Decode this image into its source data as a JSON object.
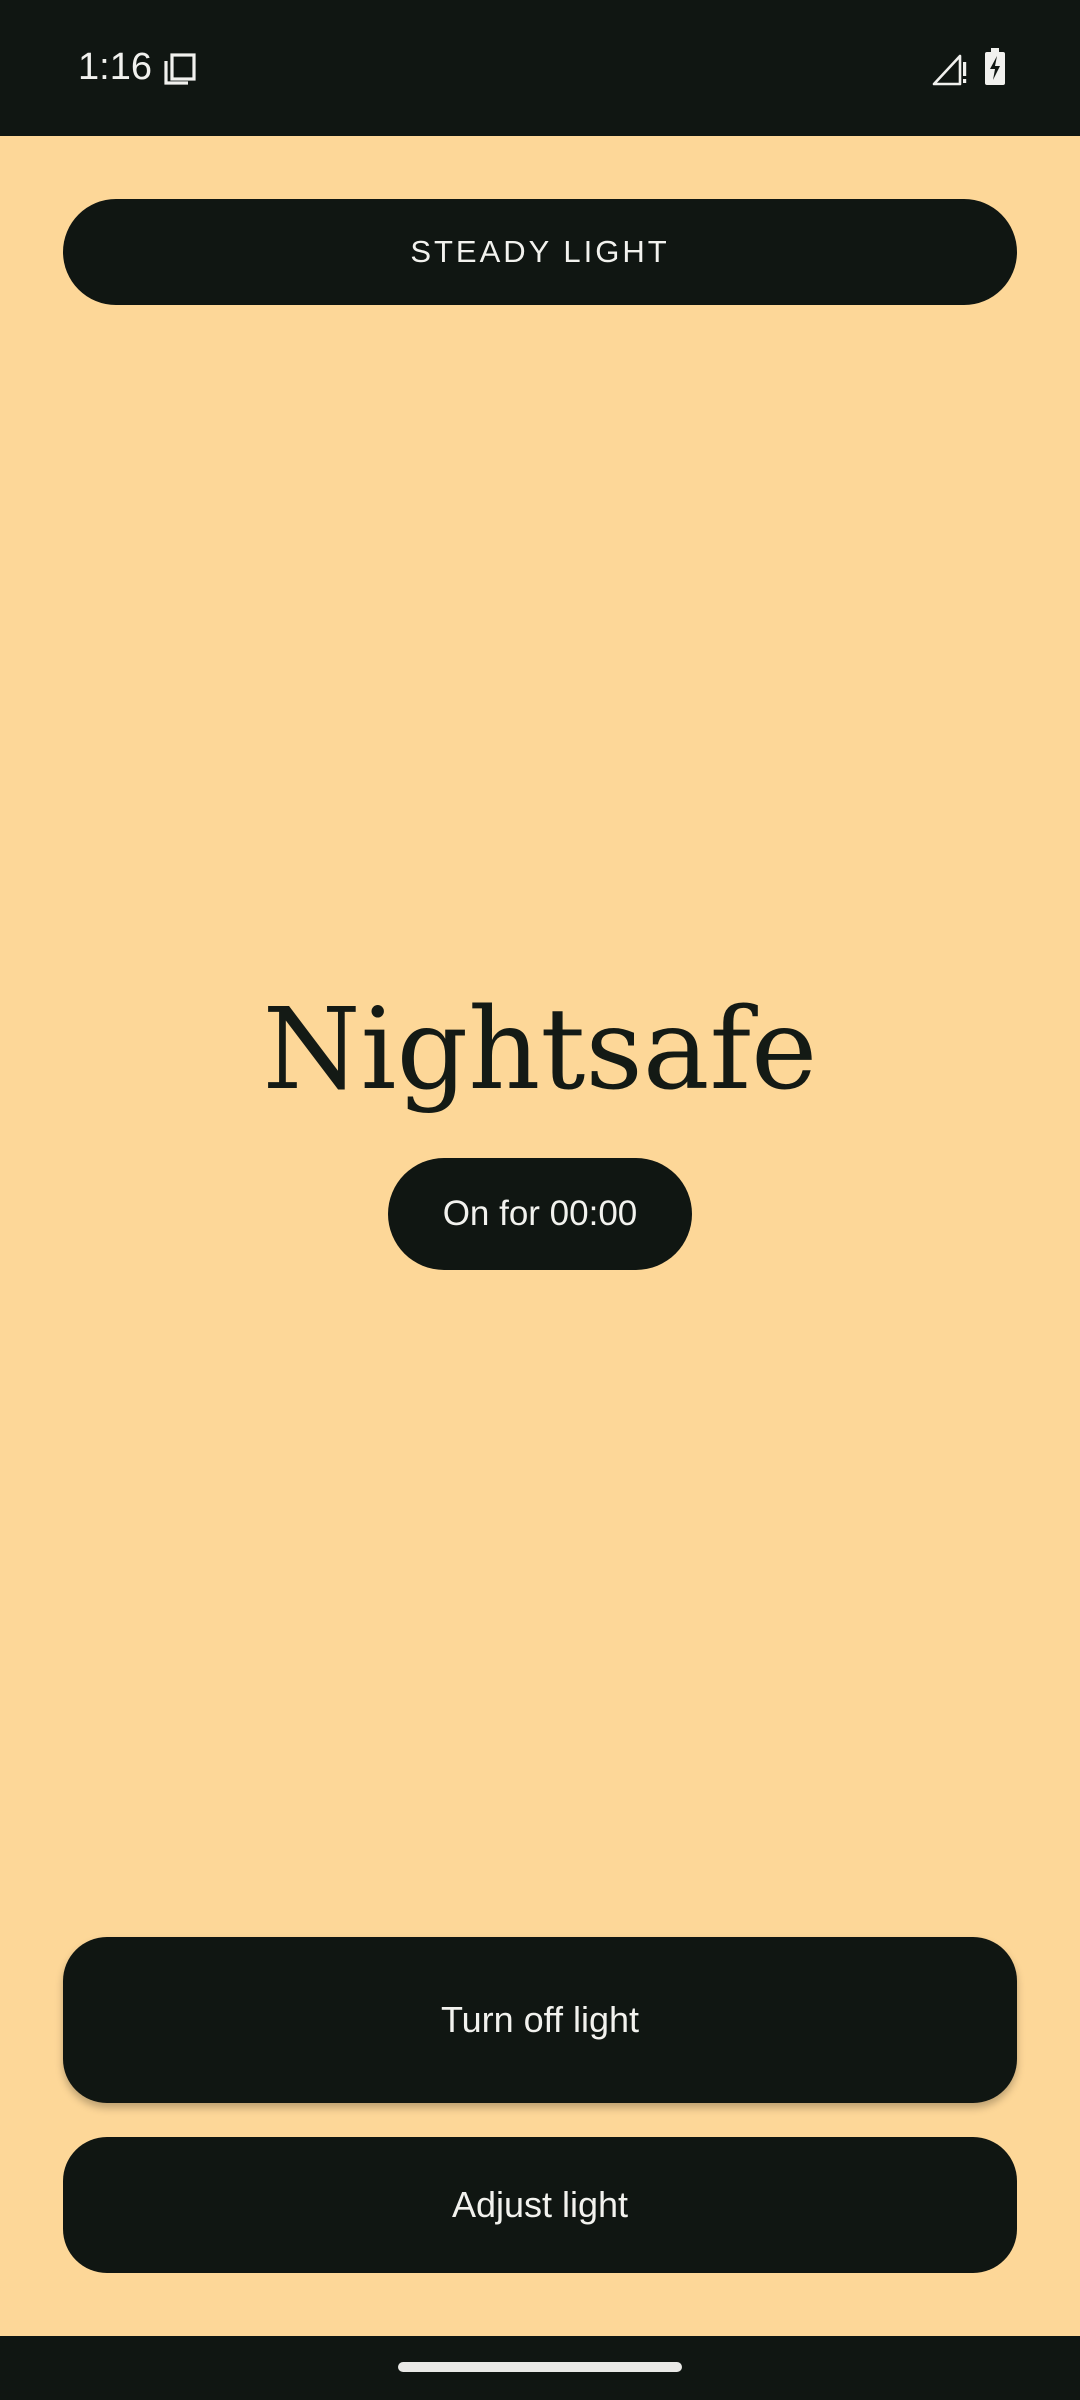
{
  "status_bar": {
    "time": "1:16",
    "icons": [
      "notification-icon",
      "signal-icon",
      "battery-charging-icon"
    ]
  },
  "mode_button": {
    "label": "STEADY LIGHT"
  },
  "main": {
    "title": "Nightsafe",
    "timer": "On for 00:00"
  },
  "actions": {
    "turn_off_label": "Turn off light",
    "adjust_label": "Adjust light"
  },
  "colors": {
    "background": "#FDD798",
    "dark": "#101612",
    "text_light": "#F2F2EE"
  }
}
